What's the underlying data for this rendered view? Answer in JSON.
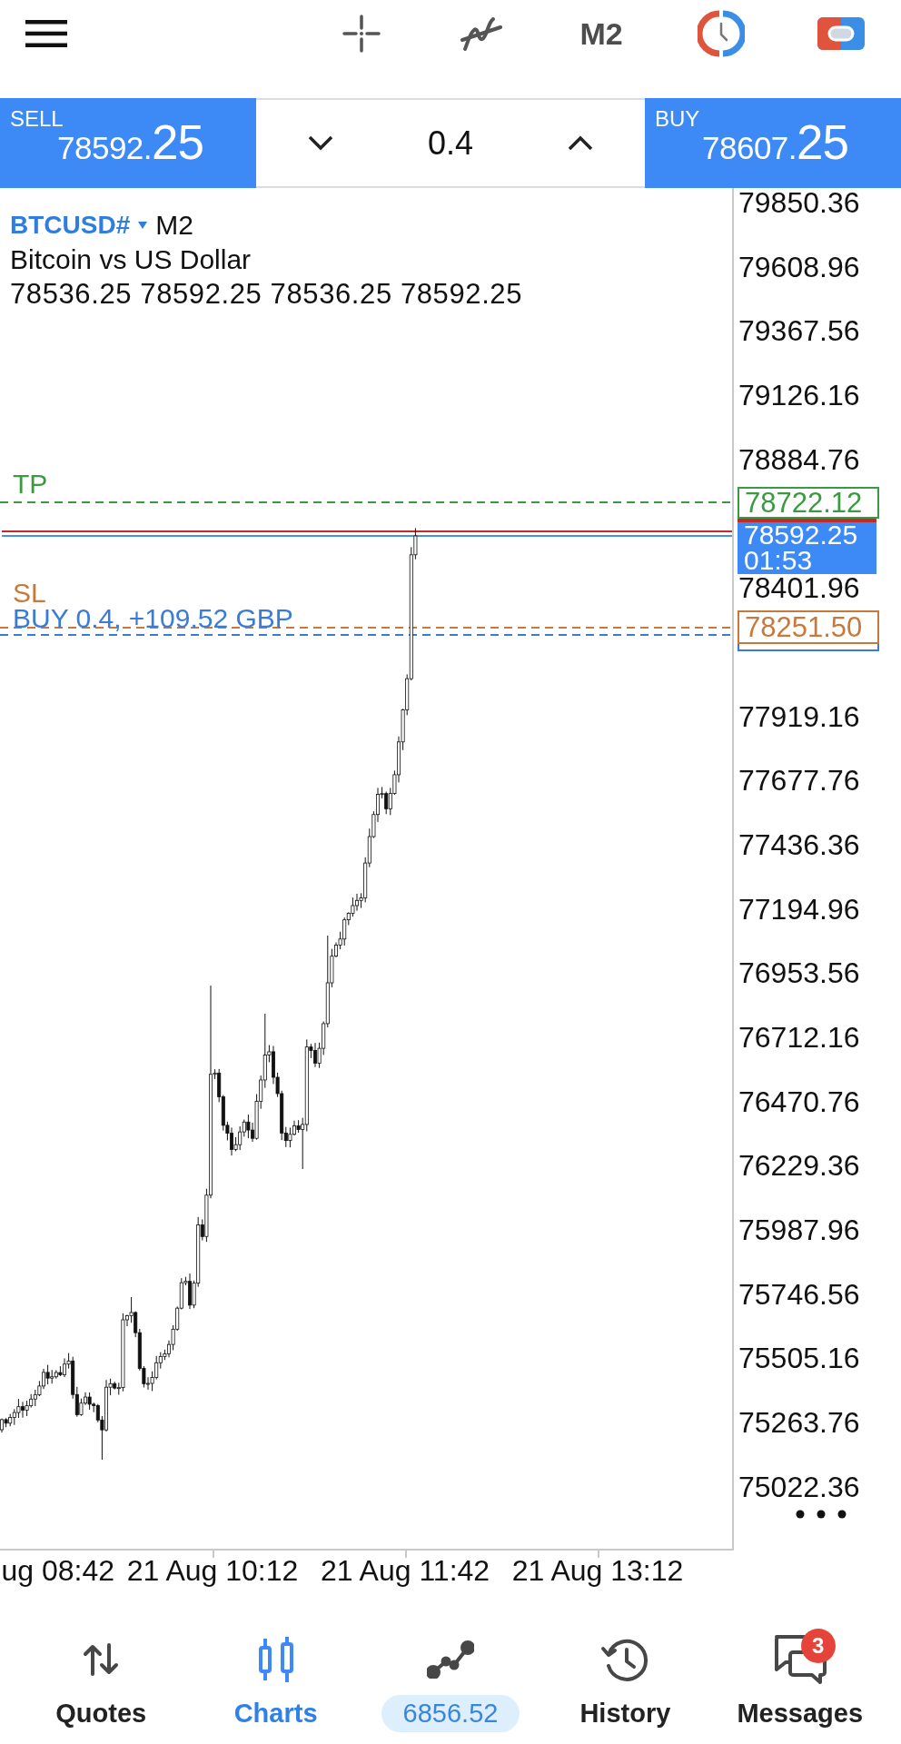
{
  "toolbar": {
    "timeframe": "M2"
  },
  "trade_panel": {
    "sell": {
      "label": "SELL",
      "price": "78592.",
      "price_big": "25"
    },
    "volume": "0.4",
    "buy": {
      "label": "BUY",
      "price": "78607.",
      "price_big": "25"
    }
  },
  "chart": {
    "symbol": "BTCUSD#",
    "timeframe": "M2",
    "description": "Bitcoin vs US Dollar",
    "ohlc": "78536.25 78592.25 78536.25 78592.25",
    "levels": [
      {
        "kind": "take_profit",
        "label": "TP",
        "price": "78722.12"
      },
      {
        "kind": "stop_loss",
        "label": "SL",
        "price": "78251.50"
      }
    ],
    "position": {
      "label": "BUY 0.4, +109.52 GBP"
    },
    "current_price": {
      "price": "78592.25",
      "countdown": "01:53"
    },
    "price_scale": {
      "labels_above_tags": [
        "79850.36",
        "79608.96",
        "79367.56",
        "79126.16",
        "78884.76"
      ],
      "labels_between_tags": [
        "78401.96"
      ],
      "labels_below_tags": [
        "77919.16",
        "77677.76",
        "77436.36",
        "77194.96",
        "76953.56",
        "76712.16",
        "76470.76",
        "76229.36",
        "75987.96",
        "75746.56",
        "75505.16",
        "75263.76",
        "75022.36"
      ]
    },
    "time_axis": [
      "ug 08:42",
      "21 Aug 10:12",
      "21 Aug 11:42",
      "21 Aug 13:12"
    ]
  },
  "bottom_nav": [
    {
      "kind": "tab",
      "label": "Quotes",
      "selected": false
    },
    {
      "kind": "tab",
      "label": "Charts",
      "selected": true
    },
    {
      "kind": "balance",
      "label": "6856.52",
      "selected": false
    },
    {
      "kind": "tab",
      "label": "History",
      "selected": false
    },
    {
      "kind": "tab",
      "label": "Messages",
      "selected": false,
      "badge": "3"
    }
  ]
}
